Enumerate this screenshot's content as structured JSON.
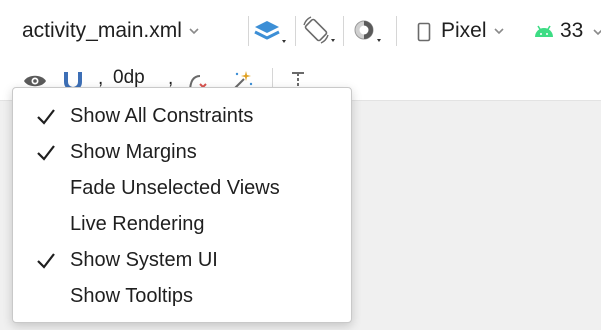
{
  "toolbar": {
    "file_name": "activity_main.xml",
    "device": "Pixel",
    "api_level": "33",
    "layers_color": "#3d8fd6",
    "android_color": "#3ddc84"
  },
  "secondary_toolbar": {
    "default_margin": "0dp"
  },
  "view_options_menu": {
    "items": [
      {
        "label": "Show All Constraints",
        "checked": true
      },
      {
        "label": "Show Margins",
        "checked": true
      },
      {
        "label": "Fade Unselected Views",
        "checked": false
      },
      {
        "label": "Live Rendering",
        "checked": false
      },
      {
        "label": "Show System UI",
        "checked": true
      },
      {
        "label": "Show Tooltips",
        "checked": false
      }
    ]
  }
}
